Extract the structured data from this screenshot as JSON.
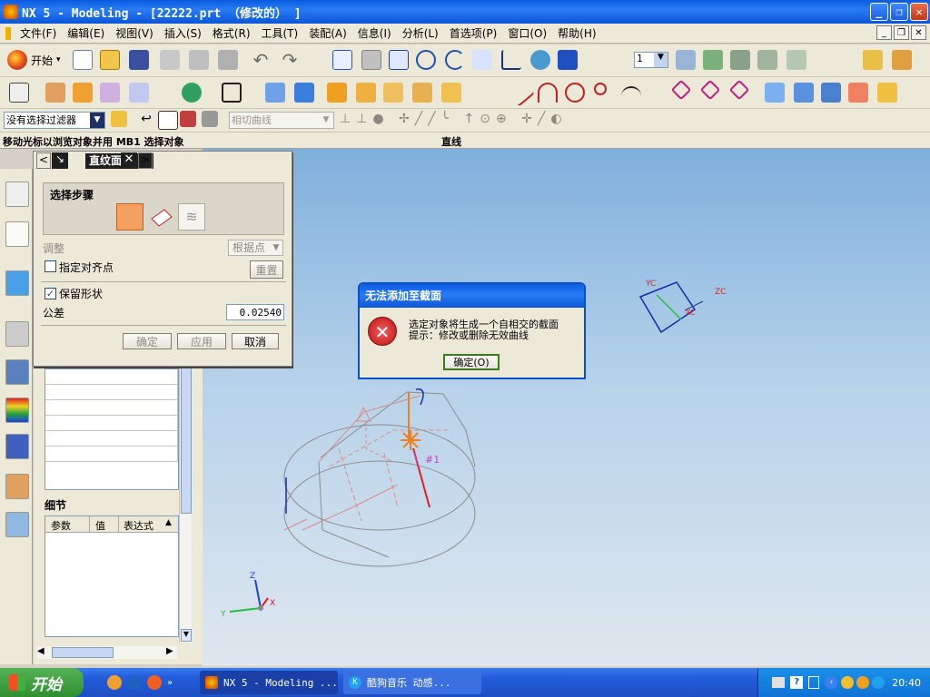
{
  "window": {
    "title": "NX 5 - Modeling - [22222.prt （修改的） ]"
  },
  "menu": [
    "文件(F)",
    "编辑(E)",
    "视图(V)",
    "插入(S)",
    "格式(R)",
    "工具(T)",
    "装配(A)",
    "信息(I)",
    "分析(L)",
    "首选项(P)",
    "窗口(O)",
    "帮助(H)"
  ],
  "toolbar": {
    "start_label": "开始",
    "layer_value": "1",
    "selection_filter": "没有选择过滤器",
    "curve_rule": "相切曲线"
  },
  "cmdbar": {
    "prompt": "移动光标以浏览对象并用 MB1 选择对象",
    "status": "直线"
  },
  "dialog": {
    "title": "直纹面",
    "group_title": "选择步骤",
    "adjust_label": "调整",
    "adjust_value": "根据点",
    "align_points_label": "指定对齐点",
    "reset_label": "重置",
    "keep_shape_label": "保留形状",
    "tolerance_label": "公差",
    "tolerance_value": "0.02540",
    "ok_label": "确定",
    "apply_label": "应用",
    "cancel_label": "取消"
  },
  "details": {
    "title": "细节",
    "columns": [
      "参数",
      "值",
      "表达式"
    ]
  },
  "error": {
    "title": "无法添加至截面",
    "line1": "选定对象将生成一个自相交的截面",
    "line2": "提示：修改或删除无效曲线",
    "ok_label": "确定(O)"
  },
  "viewport_labels": {
    "yc": "YC",
    "zc": "ZC",
    "xc": "XC",
    "section_tag": "#1",
    "axis_z": "Z",
    "axis_y": "Y",
    "axis_x": "X"
  },
  "taskbar": {
    "start": "开始",
    "task1": "NX 5 - Modeling ...",
    "task2": "酷狗音乐  动感...",
    "clock": "20:40"
  },
  "colors": {
    "xp_blue": "#0a5be0",
    "panel": "#ece9d8",
    "error_red": "#d0242b",
    "model_gray": "#8c8c8c",
    "model_pink": "#d98c8c",
    "model_orange": "#f08020",
    "model_red": "#e02020",
    "model_blue": "#1a2aa0"
  }
}
